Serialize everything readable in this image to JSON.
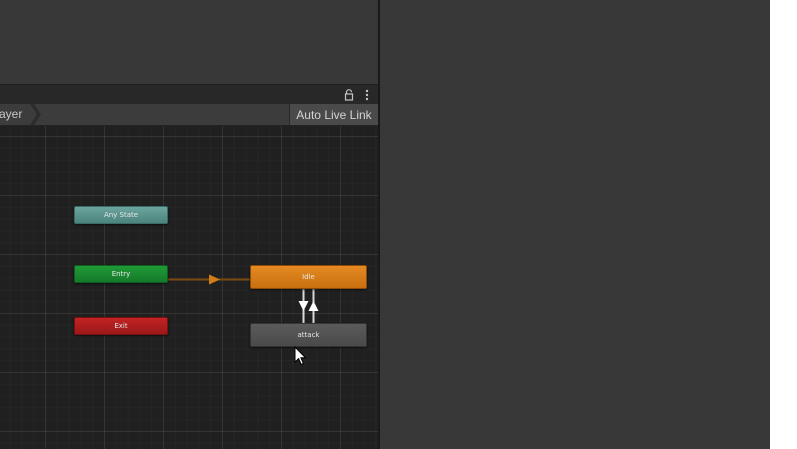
{
  "toolbar": {
    "breadcrumb": "ayer",
    "auto_live_link": "Auto Live Link"
  },
  "icons": {
    "lock": "lock-icon",
    "more": "more-vertical-icon",
    "cursor": "mouse-cursor-icon"
  },
  "graph": {
    "nodes": {
      "any_state": "Any State",
      "entry": "Entry",
      "exit": "Exit",
      "idle": "Idle",
      "attack": "attack"
    }
  },
  "colors": {
    "any_state": "#5f968f",
    "entry": "#1b8a31",
    "exit": "#b01e1e",
    "default_state": "#d87d16",
    "state": "#535353",
    "transition_default": "#d07d1a",
    "transition": "#e8e8e8"
  }
}
